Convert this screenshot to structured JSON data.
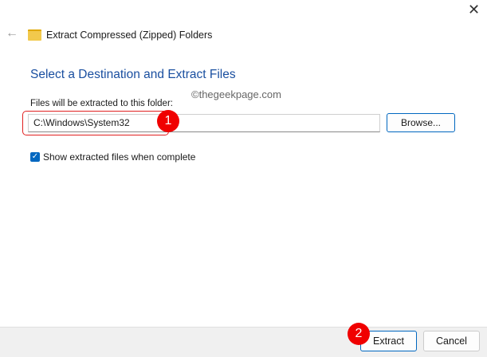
{
  "window": {
    "title": "Extract Compressed (Zipped) Folders",
    "close": "✕",
    "back": "←"
  },
  "heading": "Select a Destination and Extract Files",
  "watermark": "©thegeekpage.com",
  "folder_label": "Files will be extracted to this folder:",
  "folder_value": "C:\\Windows\\System32",
  "browse_label": "Browse...",
  "checkbox": {
    "label": "Show extracted files when complete",
    "checked": true,
    "mark": "✓"
  },
  "annotations": [
    "1",
    "2"
  ],
  "footer": {
    "extract": "Extract",
    "cancel": "Cancel"
  }
}
